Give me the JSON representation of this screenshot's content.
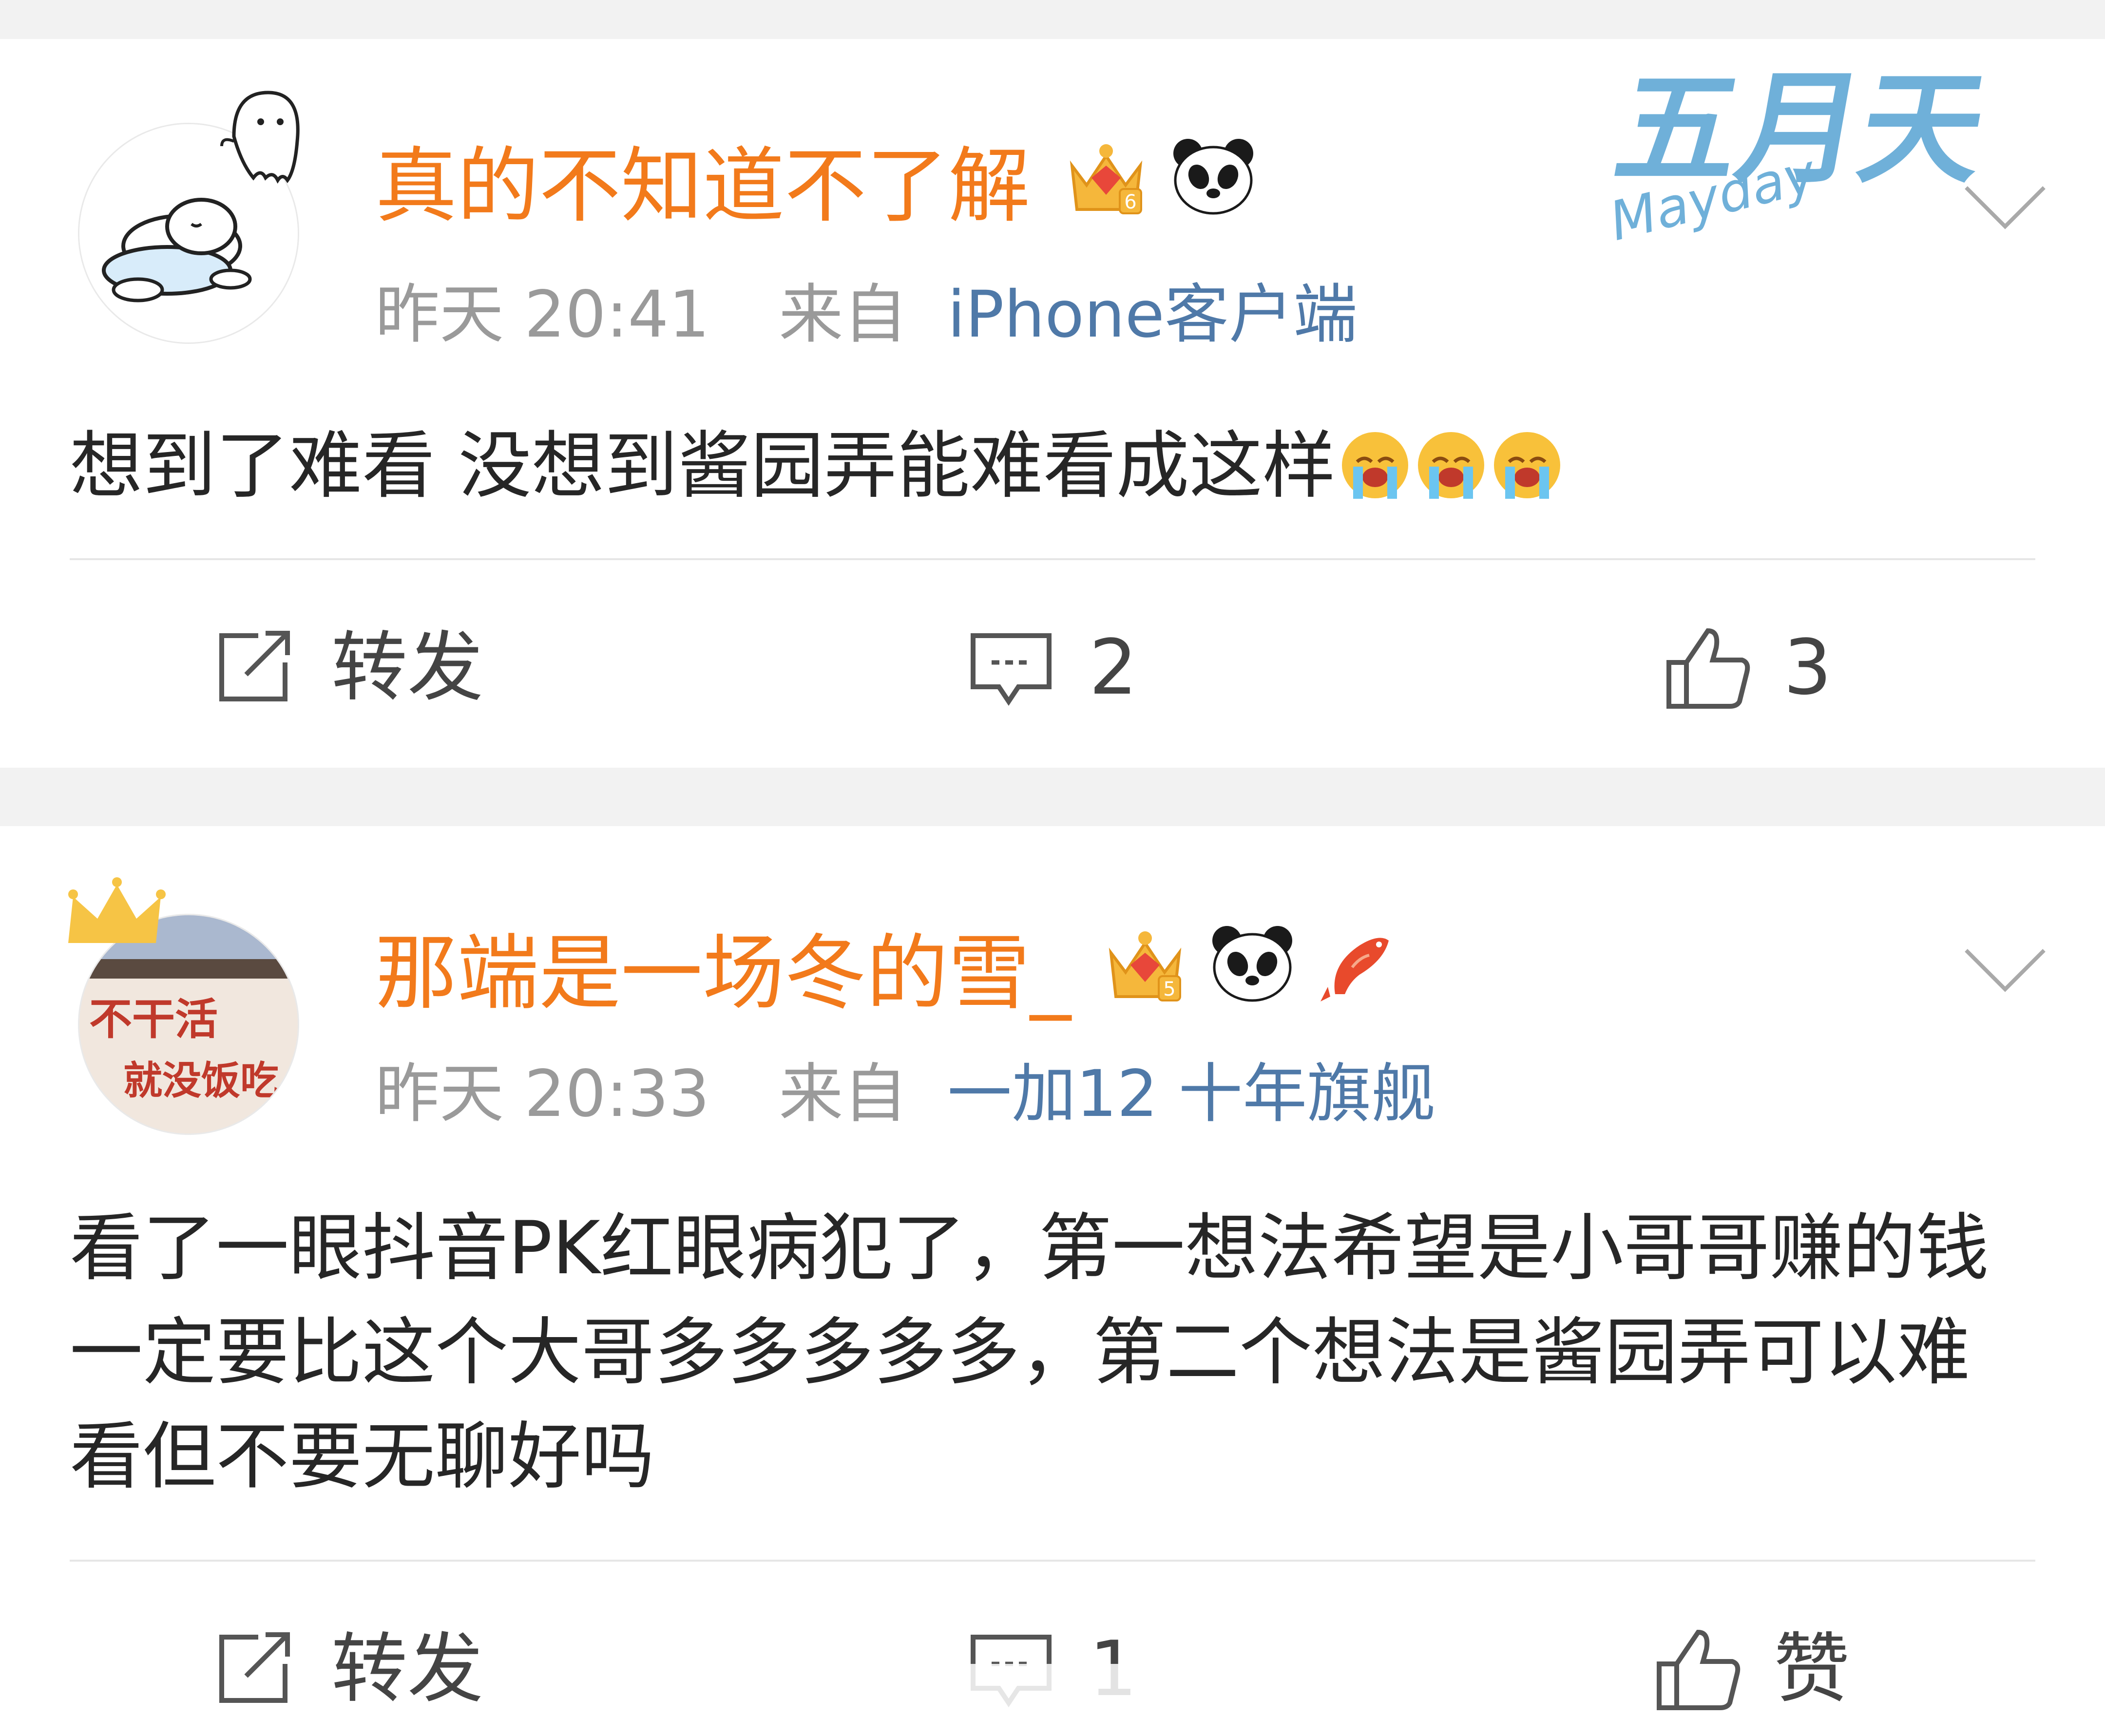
{
  "posts": [
    {
      "username": "真的不知道不了解",
      "time": "昨天 20:41",
      "from_label": "来自",
      "source": "iPhone客户端",
      "content": "想到了难看 没想到酱园弄能难看成这样",
      "emoji_names": [
        "crying-face-emoji",
        "crying-face-emoji",
        "crying-face-emoji"
      ],
      "level_badge": "6",
      "fan_badge_text": "Mayday",
      "fan_badge_title": "五月天",
      "actions": {
        "repost": "转发",
        "comment": "2",
        "like": "3"
      }
    },
    {
      "username": "那端是一场冬的雪_",
      "time": "昨天 20:33",
      "from_label": "来自",
      "source": "一加12 十年旗舰",
      "content": "看了一眼抖音PK红眼病犯了，第一想法希望是小哥哥赚的钱一定要比这个大哥多多多多多，第二个想法是酱园弄可以难看但不要无聊好吗",
      "avatar_text_1": "不干活",
      "avatar_text_2": "就没饭吃",
      "level_badge": "5",
      "actions": {
        "repost": "转发",
        "comment": "1",
        "like": "赞"
      }
    }
  ],
  "colors": {
    "username": "#f27a1b",
    "meta": "#9a9a9a",
    "source_link": "#4f79a8",
    "body": "#262626",
    "background": "#f2f2f2"
  },
  "icons": [
    "repost-icon",
    "comment-icon",
    "like-icon",
    "chevron-down-icon",
    "crown-level-badge",
    "panda-icon",
    "koi-fish-icon"
  ]
}
